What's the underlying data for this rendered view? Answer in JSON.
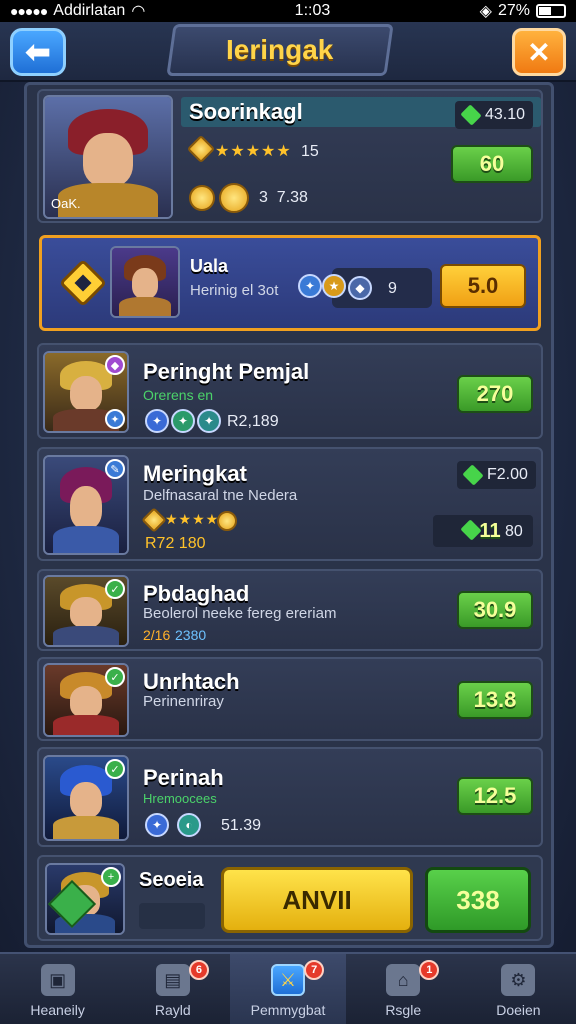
{
  "status_bar": {
    "carrier": "Addirlatan",
    "time": "1::03",
    "battery": "27%"
  },
  "header": {
    "title": "Ieringak",
    "back_icon": "arrow-left-icon",
    "close_icon": "close-icon"
  },
  "top_card": {
    "name": "Soorinkagl",
    "level": "15",
    "gem_price": "43.10",
    "buy_price": "60",
    "coin_value": "3  7.38",
    "portrait_label": "OaK."
  },
  "featured": {
    "name": "Uala",
    "subtitle": "Herinig el 3ot",
    "count": "9",
    "price": "5.0"
  },
  "list": [
    {
      "name": "Peringht Pemjal",
      "sub": "Orerens en",
      "value": "R2,189",
      "price": "270"
    },
    {
      "name": "Meringkat",
      "sub": "Delfnasaral tne Nedera",
      "value": "R72 180",
      "gem_price": "F2.00",
      "price2": "11",
      "price2b": "80"
    },
    {
      "name": "Pbdaghad",
      "sub": "Beolerol neeke fereg ereriam",
      "value_a": "2/16",
      "value_b": "2380",
      "price": "30.9"
    },
    {
      "name": "Unrhtach",
      "sub": "Perinenriray",
      "price": "13.8"
    },
    {
      "name": "Perinah",
      "sub": "Hremoocees",
      "value": "51.39",
      "price": "12.5"
    }
  ],
  "action_row": {
    "name": "Seoeia",
    "primary_label": "ANVII",
    "secondary_label": "338"
  },
  "bottom_nav": [
    {
      "label": "Heaneily",
      "icon": "cube-icon",
      "badge": ""
    },
    {
      "label": "Rayld",
      "icon": "chest-icon",
      "badge": "6"
    },
    {
      "label": "Pemmygbat",
      "icon": "hero-icon",
      "badge": "7"
    },
    {
      "label": "Rsgle",
      "icon": "shop-icon",
      "badge": "1"
    },
    {
      "label": "Doeien",
      "icon": "gear-icon",
      "badge": ""
    }
  ],
  "colors": {
    "accent_gold": "#ffd54a",
    "accent_green": "#47d44a",
    "panel": "#2a3349"
  }
}
